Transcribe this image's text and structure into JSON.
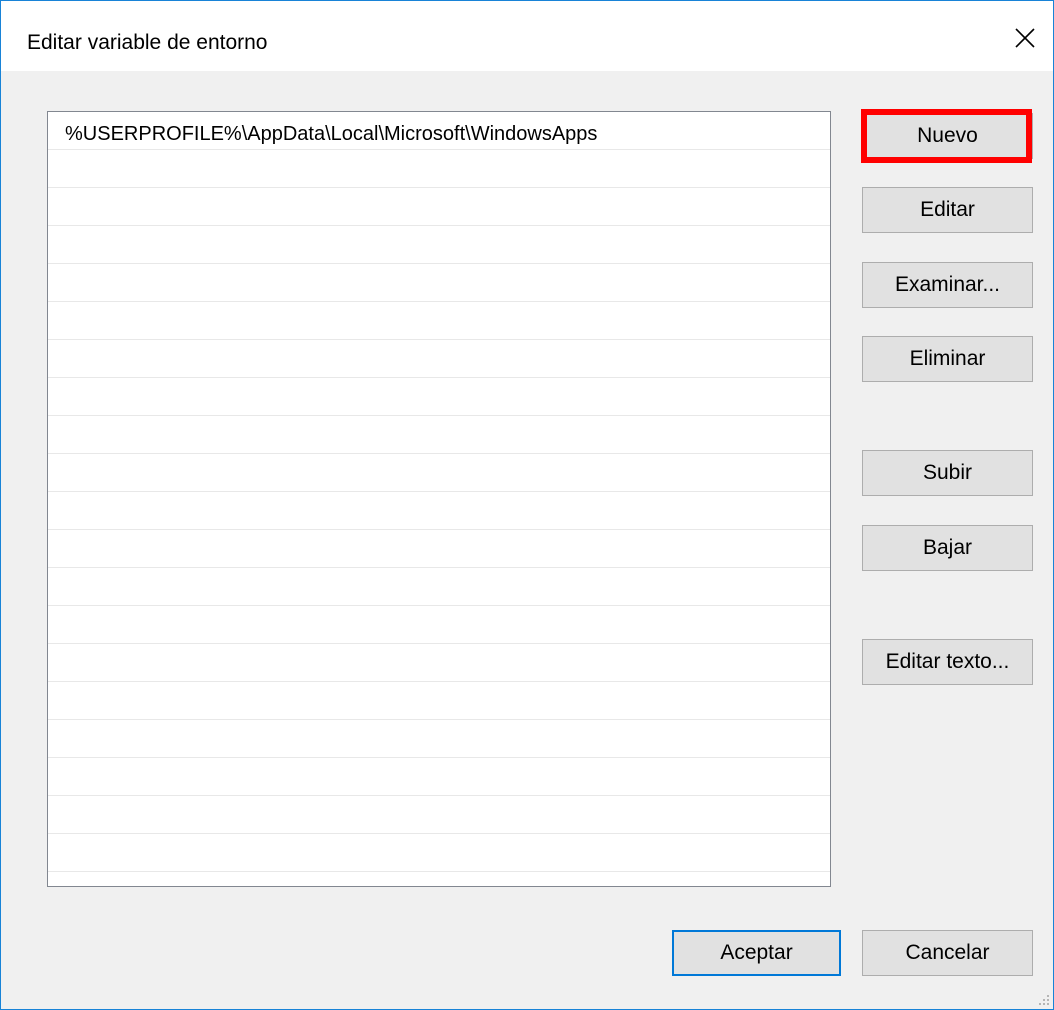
{
  "window": {
    "title": "Editar variable de entorno",
    "close_icon": "close-icon"
  },
  "list": {
    "items": [
      "%USERPROFILE%\\AppData\\Local\\Microsoft\\WindowsApps",
      "",
      "",
      "",
      "",
      "",
      "",
      "",
      "",
      "",
      "",
      "",
      "",
      "",
      "",
      "",
      "",
      "",
      "",
      "",
      ""
    ]
  },
  "buttons": {
    "nuevo": "Nuevo",
    "editar": "Editar",
    "examinar": "Examinar...",
    "eliminar": "Eliminar",
    "subir": "Subir",
    "bajar": "Bajar",
    "editar_texto": "Editar texto...",
    "aceptar": "Aceptar",
    "cancelar": "Cancelar"
  },
  "colors": {
    "highlight": "#ff0000",
    "focus": "#0078d7",
    "window_border": "#1883d7"
  }
}
